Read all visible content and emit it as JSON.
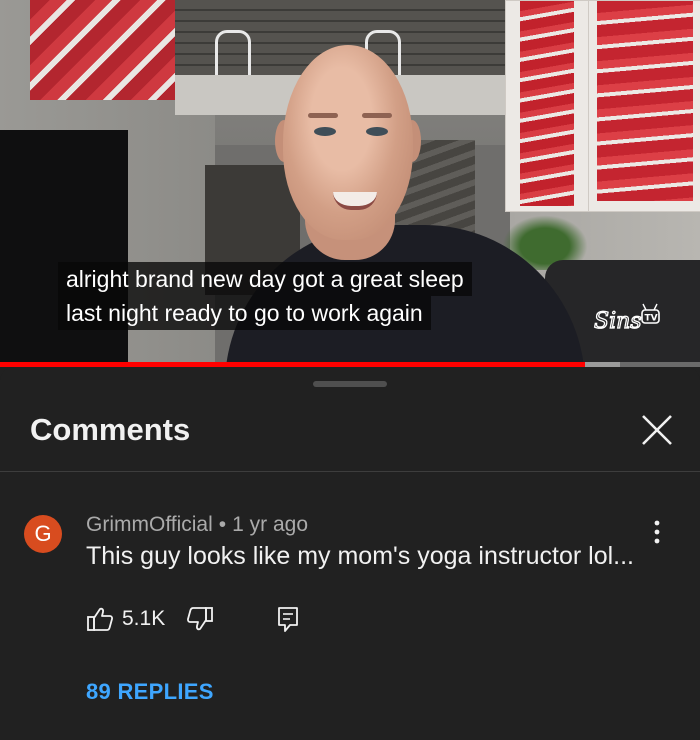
{
  "video": {
    "caption_lines": [
      "alright brand new day got a great sleep",
      "last night ready to go to work again"
    ],
    "logo_text": "Sins",
    "logo_badge": "TV",
    "progress_fraction": 0.835,
    "buffer_fraction": 0.885,
    "progress_color": "#ff0000"
  },
  "comments_panel": {
    "title": "Comments",
    "close_icon": "close-icon",
    "comment": {
      "avatar_letter": "G",
      "avatar_color": "#d84c1f",
      "author": "GrimmOfficial",
      "separator": "•",
      "age": "1 yr ago",
      "text": "This guy looks like my mom's yoga instructor lol...",
      "like_count": "5.1K",
      "icons": [
        "thumbs-up-icon",
        "thumbs-down-icon",
        "reply-icon",
        "more-vert-icon"
      ],
      "replies_label": "89 REPLIES",
      "replies_color": "#3ea6ff"
    }
  }
}
